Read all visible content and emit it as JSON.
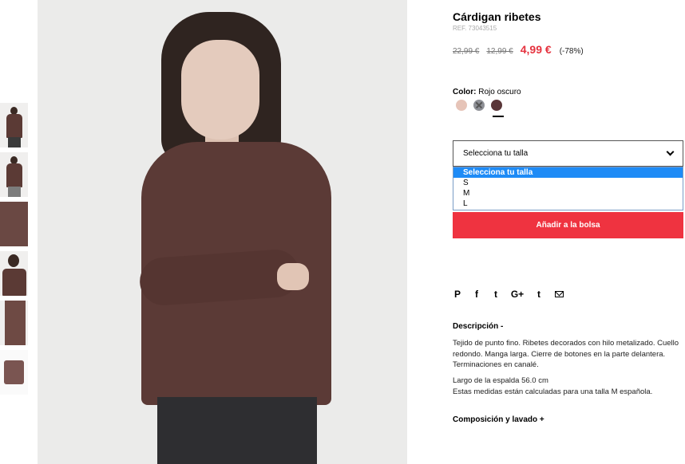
{
  "product": {
    "title": "Cárdigan ribetes",
    "ref": "REF. 73043515",
    "old_price_1": "22,99 €",
    "old_price_2": "12,99 €",
    "sale_price": "4,99 €",
    "discount": "(-78%)"
  },
  "color": {
    "label": "Color:",
    "value": "Rojo oscuro",
    "swatches": [
      {
        "color": "#e6c4b8",
        "state": "available"
      },
      {
        "color": "#8e9096",
        "state": "unavailable"
      },
      {
        "color": "#5a3638",
        "state": "selected"
      }
    ]
  },
  "size": {
    "select_label": "Selecciona tu talla",
    "options": [
      "Selecciona tu talla",
      "S",
      "M",
      "L"
    ],
    "highlighted_option": "Selecciona tu talla"
  },
  "cart": {
    "add_label": "Añadir a la bolsa",
    "accent": "#ef3340"
  },
  "social": {
    "icons": [
      "pinterest-icon",
      "facebook-icon",
      "twitter-icon",
      "google-plus-icon",
      "tumblr-icon",
      "mail-icon"
    ],
    "glyphs": {
      "pinterest": "P",
      "facebook": "f",
      "twitter": "t",
      "google_plus": "G+",
      "tumblr": "t"
    }
  },
  "description": {
    "heading": "Descripción -",
    "text": "Tejido de punto fino. Ribetes decorados con hilo metalizado. Cuello redondo. Manga larga. Cierre de botones en la parte delantera. Terminaciones en canalé.",
    "measure_1": "Largo de la espalda 56.0 cm",
    "measure_2": "Estas medidas están calculadas para una talla M española."
  },
  "composition": {
    "heading": "Composición y lavado +"
  }
}
